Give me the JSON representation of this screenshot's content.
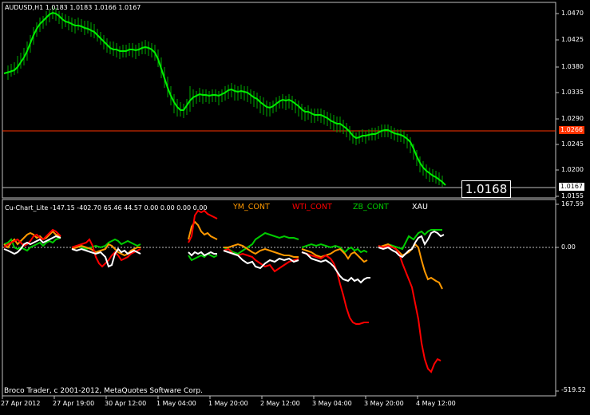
{
  "main_header": {
    "symbol": "AUDUSD,H1",
    "ohlc": "1.0183 1.0183 1.0166 1.0167"
  },
  "indicator_header": {
    "name_values": "Cu-Chart_Lite -147.15 -402.70 65.46 44.57 0.00 0.00 0.00 0.00",
    "series_names": [
      "YM_CONT",
      "WTI_CONT",
      "ZB_CONT",
      "XAU"
    ]
  },
  "price_axis": [
    "1.0470",
    "1.0425",
    "1.0380",
    "1.0335",
    "1.0290",
    "1.0245",
    "1.0200",
    "1.0155"
  ],
  "price_tags": {
    "horizontal_level": "1.0266",
    "last_bid": "1.0167",
    "big_price": "1.0168"
  },
  "indicator_axis": [
    "167.59",
    "0.00",
    "-519.52"
  ],
  "time_axis": [
    "27 Apr 2012",
    "27 Apr 19:00",
    "30 Apr 12:00",
    "1 May 04:00",
    "1 May 20:00",
    "2 May 12:00",
    "3 May 04:00",
    "3 May 20:00",
    "4 May 12:00"
  ],
  "copyright": "Broco Trader, c 2001-2012, MetaQuotes Software Corp.",
  "colors": {
    "background": "#000000",
    "price_line": "#00ff00",
    "candle_bars": "#00aa00",
    "level_line": "#ff3300",
    "ym_cont": "#ff9900",
    "wti_cont": "#ff0000",
    "zb_cont": "#00cc00",
    "xau": "#ffffff",
    "grid": "#c0c0c0"
  }
}
